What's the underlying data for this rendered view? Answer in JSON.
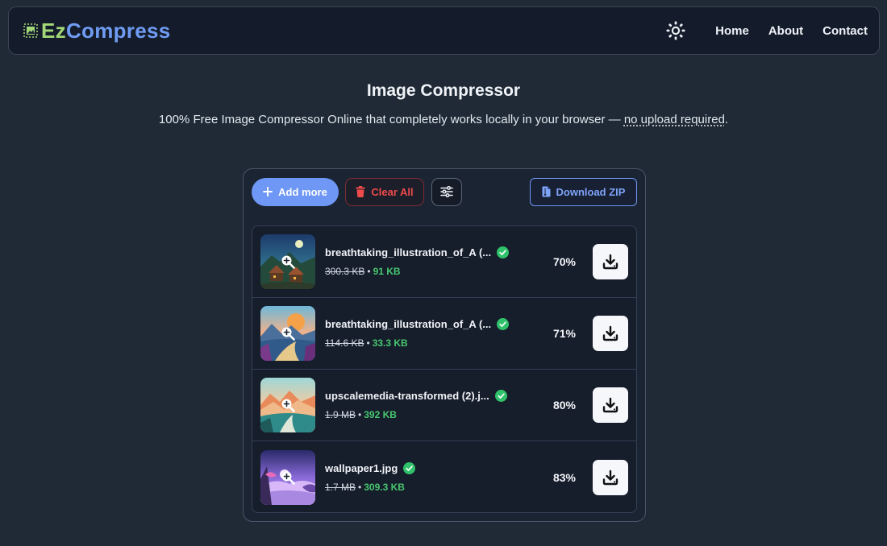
{
  "nav": {
    "brand_prefix": "Ez",
    "brand_suffix": "Compress",
    "links": [
      "Home",
      "About",
      "Contact"
    ]
  },
  "header": {
    "title": "Image Compressor",
    "subtitle_main": "100% Free Image Compressor Online that completely works locally in your browser — ",
    "subtitle_emph": "no upload required",
    "subtitle_end": "."
  },
  "toolbar": {
    "add_label": "Add more",
    "clear_label": "Clear All",
    "zip_label": "Download ZIP"
  },
  "files": [
    {
      "name": "breathtaking_illustration_of_A (...",
      "old_size": "300.3 KB",
      "new_size": "91 KB",
      "percent": "70%"
    },
    {
      "name": "breathtaking_illustration_of_A (...",
      "old_size": "114.6 KB",
      "new_size": "33.3 KB",
      "percent": "71%"
    },
    {
      "name": "upscalemedia-transformed (2).j...",
      "old_size": "1.9 MB",
      "new_size": "392 KB",
      "percent": "80%"
    },
    {
      "name": "wallpaper1.jpg",
      "old_size": "1.7 MB",
      "new_size": "309.3 KB",
      "percent": "83%"
    }
  ],
  "colors": {
    "accent": "#6f97f6",
    "danger": "#ef4b4b",
    "success": "#47c76f",
    "brand_green": "#a3d977"
  },
  "icons": {
    "theme": "sun-icon",
    "add": "plus-icon",
    "clear": "trash-icon",
    "settings": "sliders-icon",
    "zip": "file-zip-icon",
    "status": "check-circle-icon",
    "preview": "zoom-in-icon",
    "download": "download-icon"
  }
}
